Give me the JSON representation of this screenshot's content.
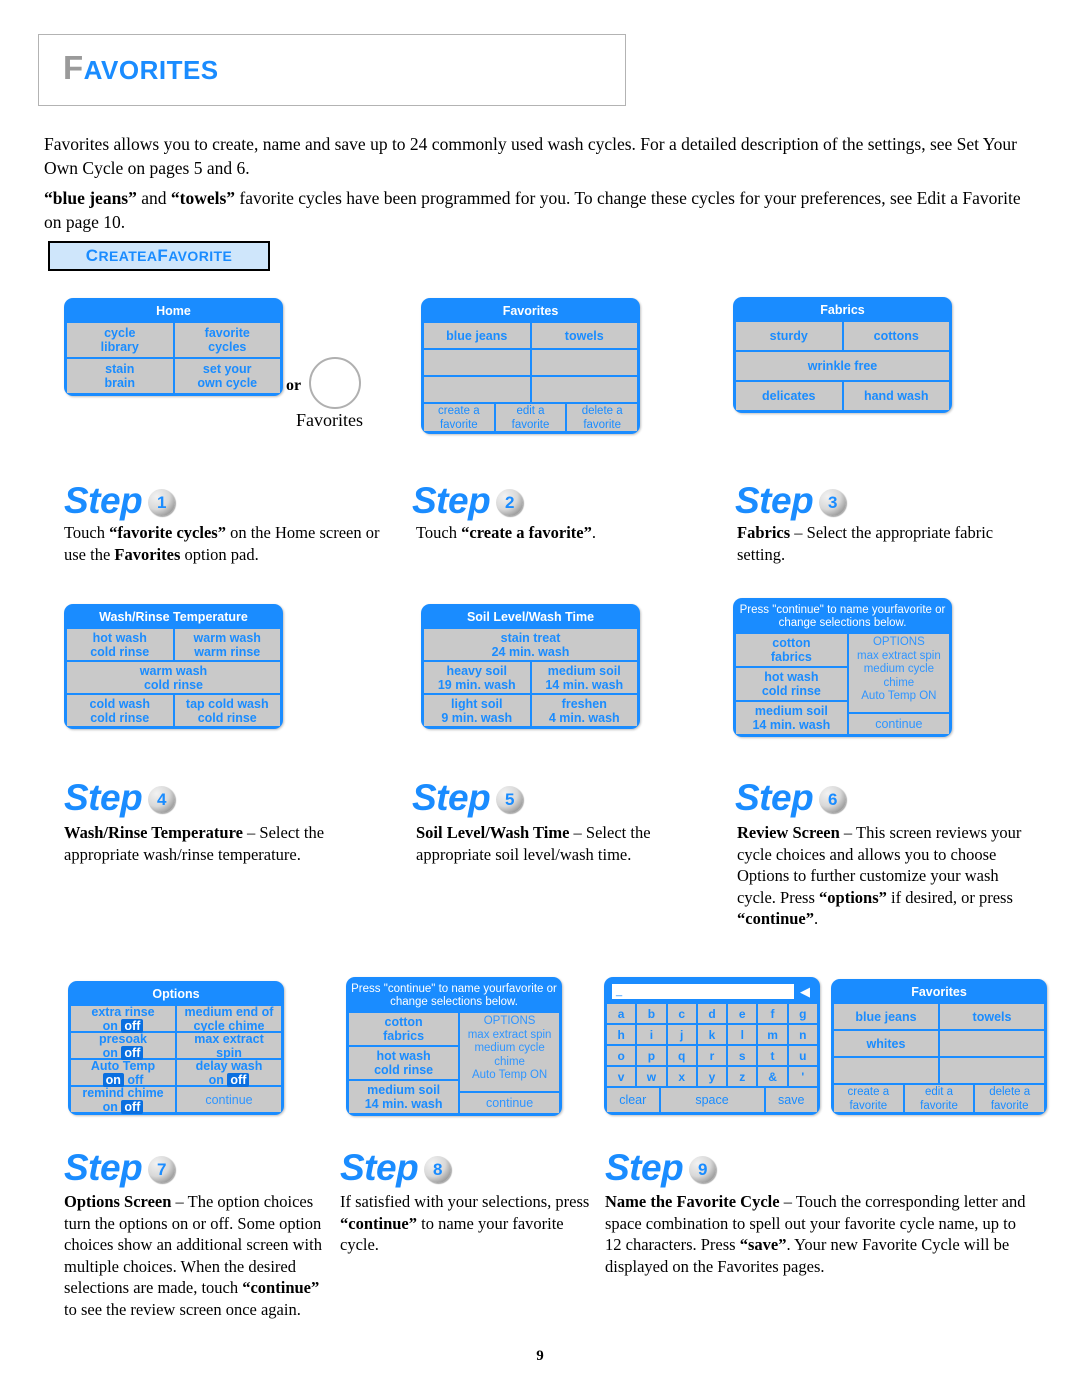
{
  "header": {
    "cap": "F",
    "rest": "AVORITES"
  },
  "intro": {
    "p1_a": "Favorites allows you to create, name and save up to 24 commonly used wash cycles.  For a detailed description of the settings, see Set Your Own Cycle on pages 5 and 6.",
    "p2_pre": "",
    "p2_b1": "“blue jeans”",
    "p2_mid1": " and ",
    "p2_b2": "“towels”",
    "p2_rest": " favorite cycles have been programmed for you. To change these cycles for your preferences, see Edit a Favorite on page 10."
  },
  "tag": {
    "c": "C",
    "reate": "REATE",
    "a": " A ",
    "f": "F",
    "avorite": "AVORITE"
  },
  "or_block": {
    "or": "or",
    "label": "Favorites",
    "icon": "circle-button-icon"
  },
  "panels": {
    "home": {
      "title": "Home",
      "cells": [
        [
          "cycle\nlibrary",
          "favorite\ncycles"
        ],
        [
          "stain\nbrain",
          "set your\nown cycle"
        ]
      ]
    },
    "favorites1": {
      "title": "Favorites",
      "rows": [
        [
          "blue jeans",
          "towels"
        ],
        [
          "",
          ""
        ],
        [
          "",
          ""
        ]
      ],
      "nav": [
        "create a\nfavorite",
        "edit a\nfavorite",
        "delete a\nfavorite"
      ]
    },
    "fabrics": {
      "title": "Fabrics",
      "row1": [
        "sturdy",
        "cottons"
      ],
      "row2": [
        "wrinkle free"
      ],
      "row3": [
        "delicates",
        "hand wash"
      ]
    },
    "washrinse": {
      "title": "Wash/Rinse Temperature",
      "row1": [
        "hot wash\ncold rinse",
        "warm wash\nwarm rinse"
      ],
      "row2": [
        "warm wash\ncold rinse"
      ],
      "row3": [
        "cold wash\ncold rinse",
        "tap cold wash\ncold rinse"
      ]
    },
    "soil": {
      "title": "Soil Level/Wash Time",
      "row1": [
        "stain treat\n24 min. wash"
      ],
      "row2": [
        "heavy soil\n19 min. wash",
        "medium soil\n14 min. wash"
      ],
      "row3": [
        "light soil\n9 min. wash",
        "freshen\n4 min. wash"
      ]
    },
    "review": {
      "title": "Press \"continue\" to name your\nfavorite or change selections below.",
      "left": [
        "cotton\nfabrics",
        "hot wash\ncold rinse",
        "medium soil\n14 min. wash"
      ],
      "options_header": "OPTIONS",
      "options_lines": [
        "max extract spin",
        "medium cycle chime",
        "Auto Temp ON"
      ],
      "continue": "continue"
    },
    "options": {
      "title": "Options",
      "rows": [
        {
          "left_label": "extra rinse",
          "left_on": "on",
          "left_off": "off",
          "left_state": "off",
          "right_line1": "medium end of",
          "right_line2": "cycle chime"
        },
        {
          "left_label": "presoak",
          "left_on": "on",
          "left_off": "off",
          "left_state": "off",
          "right_line1": "max extract",
          "right_line2": "spin"
        },
        {
          "left_label": "Auto Temp",
          "left_on": "on",
          "left_off": "off",
          "left_state": "on",
          "right_line1": "delay wash",
          "right_on": "on",
          "right_off": "off",
          "right_state": "off"
        },
        {
          "left_label": "remind chime",
          "left_on": "on",
          "left_off": "off",
          "left_state": "off",
          "right_line1": "continue"
        }
      ]
    },
    "keyboard": {
      "display_value": "_",
      "backspace_icon": "backspace-arrow-icon",
      "rows": [
        [
          "a",
          "b",
          "c",
          "d",
          "e",
          "f",
          "g"
        ],
        [
          "h",
          "i",
          "j",
          "k",
          "l",
          "m",
          "n"
        ],
        [
          "o",
          "p",
          "q",
          "r",
          "s",
          "t",
          "u"
        ],
        [
          "v",
          "w",
          "x",
          "y",
          "z",
          "&",
          "'"
        ]
      ],
      "bottom": [
        "clear",
        "space",
        "save"
      ]
    },
    "favorites2": {
      "title": "Favorites",
      "rows": [
        [
          "blue jeans",
          "towels"
        ],
        [
          "whites",
          ""
        ],
        [
          "",
          ""
        ]
      ],
      "nav": [
        "create a\nfavorite",
        "edit a\nfavorite",
        "delete a\nfavorite"
      ]
    }
  },
  "steps": {
    "word": "Step",
    "s1": {
      "num": "1",
      "text_html": "Touch <b>“favorite cycles”</b> on the Home screen or use the <b>Favorites</b> option pad."
    },
    "s2": {
      "num": "2",
      "text_html": "Touch <b>“create a favorite”</b>."
    },
    "s3": {
      "num": "3",
      "text_html": "<b>Fabrics</b> – Select the appropriate fabric setting."
    },
    "s4": {
      "num": "4",
      "text_html": "<b>Wash/Rinse Temperature</b> – Select the appropriate wash/rinse temperature."
    },
    "s5": {
      "num": "5",
      "text_html": "<b>Soil Level/Wash Time</b> – Select the appropriate soil level/wash time."
    },
    "s6": {
      "num": "6",
      "text_html": "<b>Review Screen</b> – This screen reviews your cycle choices and allows you to choose Options to further customize your wash cycle.  Press <b>“options”</b> if desired, or press <b>“continue”</b>."
    },
    "s7": {
      "num": "7",
      "text_html": "<b>Options Screen</b> – The option choices turn the options on or off. Some option choices show an additional screen with multiple choices.  When the desired selections are made, touch <b>“continue”</b> to see the review screen once again."
    },
    "s8": {
      "num": "8",
      "text_html": "If satisfied with your selections, press <b>“continue”</b> to name your favorite cycle."
    },
    "s9": {
      "num": "9",
      "text_html": "<b>Name the Favorite Cycle</b> – Touch the corresponding letter and space combination to spell out your favorite cycle name, up to 12 characters.  Press <b>“save”</b>. Your new Favorite Cycle will be displayed on the Favorites pages."
    }
  },
  "page_number": "9",
  "colors": {
    "accent": "#1a8cff",
    "cell": "#c9c9c9",
    "tag_bg": "#cfe6fb"
  }
}
